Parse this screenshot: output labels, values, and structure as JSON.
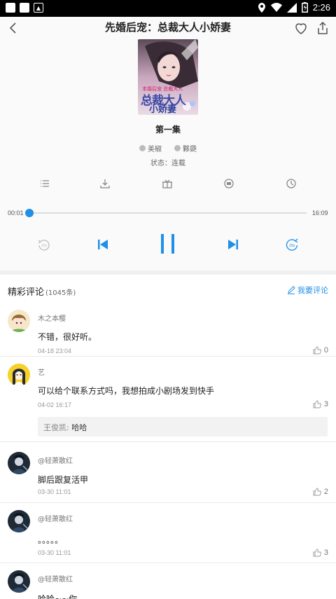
{
  "status_bar": {
    "time": "2:26"
  },
  "header": {
    "title": "先婚后宠：总裁大人小娇妻"
  },
  "book": {
    "cover_text_1": "本婚后宠 总裁大人",
    "cover_text_2": "总裁大人",
    "cover_text_3": "小娇妻",
    "episode": "第一集",
    "author": "美椒",
    "narrator": "夥瓞",
    "state": "状态：连载"
  },
  "player": {
    "current_time": "00:01",
    "total_time": "16:09",
    "progress_fraction": 0.001,
    "rewind_label": "15s",
    "forward_label": "15s"
  },
  "comments_section": {
    "title": "精彩评论",
    "count": "(1045条)",
    "write_label": "我要评论"
  },
  "comments": [
    {
      "user": "木之本樱",
      "text": "不错，很好听。",
      "date": "04-18 23:04",
      "likes": "0"
    },
    {
      "user": "艺",
      "text": "可以给个联系方式吗，我想拍成小剧场发到快手",
      "date": "04-02 16:17",
      "likes": "3",
      "reply_user": "王俊凯: ",
      "reply_text": "哈哈"
    },
    {
      "user": "@轻萧散红",
      "text": "脚后跟复活甲",
      "date": "03-30 11:01",
      "likes": "2"
    },
    {
      "user": "@轻萧散红",
      "text": "。。。。。",
      "date": "03-30 11:01",
      "likes": "3"
    },
    {
      "user": "@轻萧散红",
      "text": "哈哈~~你"
    }
  ],
  "colors": {
    "accent": "#1e90e8"
  }
}
